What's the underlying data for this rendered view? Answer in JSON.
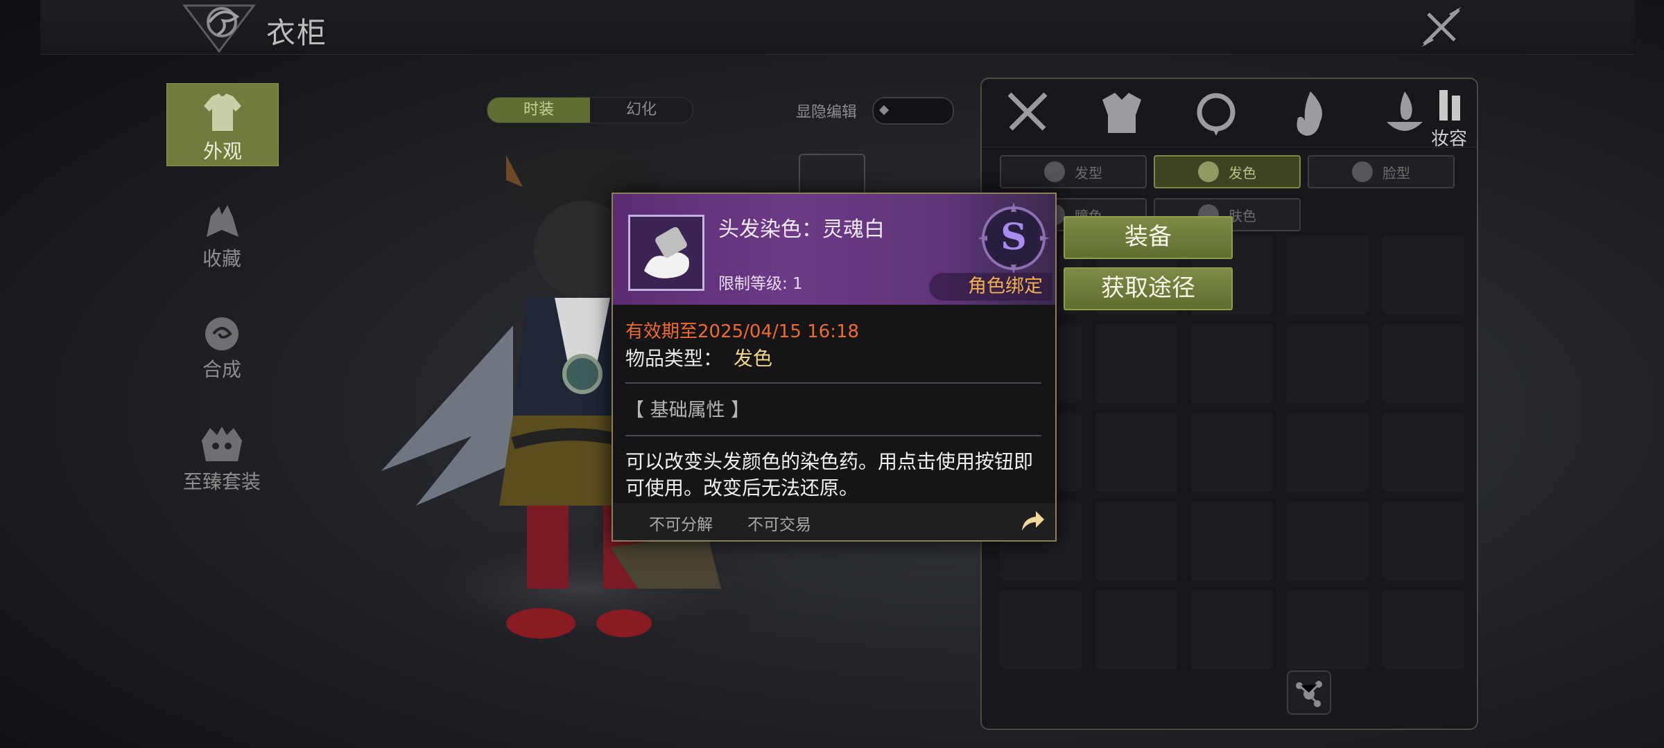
{
  "header": {
    "title": "衣柜"
  },
  "sidebar": {
    "items": [
      {
        "label": "外观",
        "active": true
      },
      {
        "label": "收藏"
      },
      {
        "label": "合成"
      },
      {
        "label": "至臻套装"
      }
    ]
  },
  "mode_tabs": [
    {
      "label": "时装",
      "active": true
    },
    {
      "label": "幻化"
    }
  ],
  "edit_toggle": {
    "label": "显隐编辑"
  },
  "panel": {
    "categories": [
      {
        "icon": "swords-icon"
      },
      {
        "icon": "armor-icon"
      },
      {
        "icon": "necklace-icon"
      },
      {
        "icon": "flame-icon"
      },
      {
        "icon": "fire-bowl-icon"
      },
      {
        "icon": "makeup-icon",
        "label": "妆容",
        "active": true
      }
    ],
    "sub_tabs": [
      {
        "label": "发型"
      },
      {
        "label": "发色",
        "active": true
      },
      {
        "label": "脸型"
      },
      {
        "label": "瞳色"
      },
      {
        "label": "肤色"
      }
    ]
  },
  "tooltip": {
    "name": "头发染色：灵魂白",
    "level": "限制等级: 1",
    "grade": "S",
    "bind": "角色绑定",
    "expire": "有效期至2025/04/15 16:18",
    "type_label": "物品类型：",
    "type_value": "发色",
    "attr_title": "【 基础属性 】",
    "description": "可以改变头发颜色的染色药。用点击使用按钮即可使用。改变后无法还原。",
    "flags": [
      "不可分解",
      "不可交易"
    ]
  },
  "actions": {
    "equip": "装备",
    "obtain": "获取途径"
  },
  "colors": {
    "accent_green": "#6f7c3c",
    "expire_red": "#ef6a2e",
    "bind_orange": "#f0b04e",
    "header_purple": "#6d3a87"
  }
}
